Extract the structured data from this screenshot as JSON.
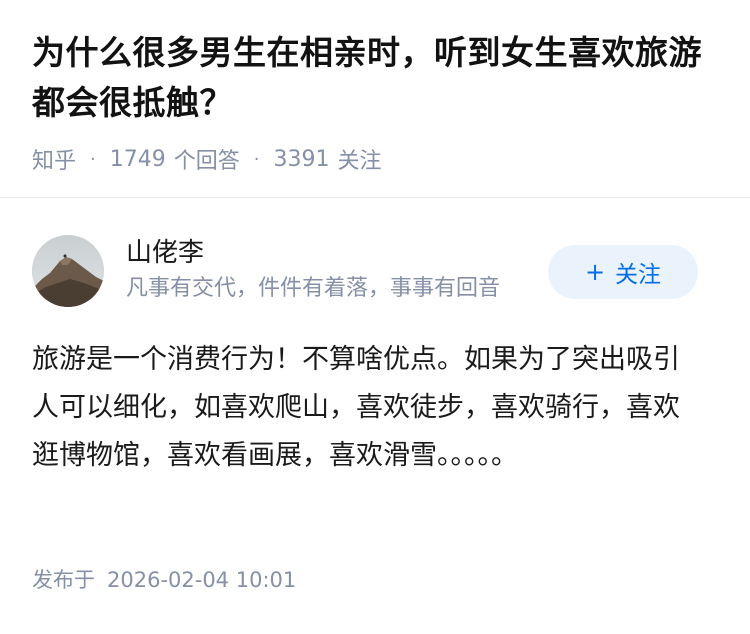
{
  "question": {
    "title": "为什么很多男生在相亲时，听到女生喜欢旅游都会很抵触？",
    "source": "知乎",
    "answer_count": "1749",
    "answer_label": "个回答",
    "follower_count": "3391",
    "follower_label": "关注"
  },
  "author": {
    "name": "山佬李",
    "bio": "凡事有交代，件件有着落，事事有回音",
    "follow_button": "关注",
    "follow_icon": "plus-icon"
  },
  "answer": {
    "content": "旅游是一个消费行为！不算啥优点。如果为了突出吸引人可以细化，如喜欢爬山，喜欢徒步，喜欢骑行，喜欢逛博物馆，喜欢看画展，喜欢滑雪。。。。。",
    "publish_label": "发布于",
    "publish_time": "2026-02-04 10:01"
  },
  "colors": {
    "meta_gray": "#8590a6",
    "accent_blue": "#056de8",
    "button_bg": "#eaf3fb"
  }
}
